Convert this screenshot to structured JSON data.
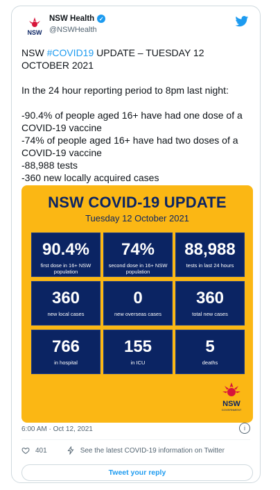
{
  "tweet": {
    "display_name": "NSW Health",
    "handle": "@NSWHealth",
    "avatar_text": "NSW",
    "text_prefix": "NSW ",
    "hashtag": "#COVID19",
    "text_rest": " UPDATE – TUESDAY 12 OCTOBER 2021\n\nIn the 24 hour reporting period to 8pm last night:\n\n-90.4% of people aged 16+ have had one dose of a COVID-19 vaccine\n-74% of people aged 16+ have had two doses of a COVID-19 vaccine\n-88,988 tests\n-360 new locally acquired cases",
    "timestamp": "6:00 AM · Oct 12, 2021",
    "likes": "401",
    "share_text": "See the latest COVID-19 information on Twitter",
    "reply_button": "Tweet your reply"
  },
  "infographic": {
    "title": "NSW COVID-19 UPDATE",
    "date": "Tuesday 12 October 2021",
    "tiles": [
      {
        "value": "90.4%",
        "label": "first dose in 16+ NSW population"
      },
      {
        "value": "74%",
        "label": "second dose in 16+ NSW population"
      },
      {
        "value": "88,988",
        "label": "tests in last 24 hours"
      },
      {
        "value": "360",
        "label": "new local cases"
      },
      {
        "value": "0",
        "label": "new overseas cases"
      },
      {
        "value": "360",
        "label": "total new cases"
      },
      {
        "value": "766",
        "label": "in hospital"
      },
      {
        "value": "155",
        "label": "in ICU"
      },
      {
        "value": "5",
        "label": "deaths"
      }
    ],
    "logo_text": "NSW",
    "logo_subtext": "GOVERNMENT"
  },
  "colors": {
    "accent": "#1d9bf0",
    "infographic_bg": "#fbb714",
    "tile_bg": "#0b2463"
  }
}
